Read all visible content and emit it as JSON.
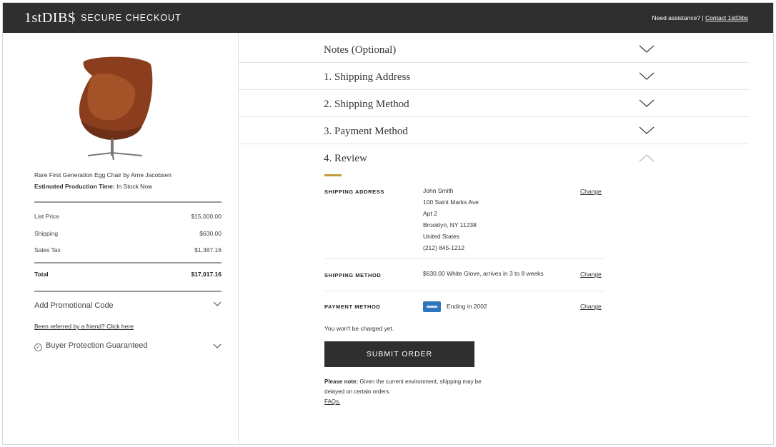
{
  "header": {
    "logo": "1stDIBS",
    "title": "SECURE CHECKOUT",
    "assist_text": "Need assistance? |",
    "contact_link": "Contact 1stDibs"
  },
  "product": {
    "name": "Rare First Generation Egg Chair by Arne Jacobsen",
    "production_label": "Estimated Production Time:",
    "production_value": "In Stock Now"
  },
  "summary": {
    "rows": [
      {
        "label": "List Price",
        "value": "$15,000.00"
      },
      {
        "label": "Shipping",
        "value": "$630.00"
      },
      {
        "label": "Sales Tax",
        "value": "$1,387.16"
      }
    ],
    "total_label": "Total",
    "total_value": "$17,017.16"
  },
  "promo": {
    "label": "Add Promotional Code",
    "referral": "Been referred by a friend? Click here",
    "protection": "Buyer Protection Guaranteed"
  },
  "sections": [
    {
      "title": "Notes (Optional)"
    },
    {
      "title": "1. Shipping Address"
    },
    {
      "title": "2. Shipping Method"
    },
    {
      "title": "3. Payment Method"
    },
    {
      "title": "4. Review"
    }
  ],
  "review": {
    "shipping_address_label": "SHIPPING ADDRESS",
    "address_lines": [
      "John Smith",
      "100 Saint Marks Ave",
      "Apt 2",
      "Brooklyn, NY 11238",
      "United States",
      "(212) 845-1212"
    ],
    "shipping_method_label": "SHIPPING METHOD",
    "shipping_method_value": "$630.00 White Glove, arrives in 3 to 8 weeks",
    "payment_method_label": "PAYMENT METHOD",
    "payment_method_value": "Ending in 2002",
    "change_label": "Change",
    "not_charged": "You won't be charged yet.",
    "submit_label": "SUBMIT ORDER",
    "please_note_label": "Please note:",
    "please_note_text": "Given the current environment, shipping may be delayed on certain orders.",
    "faqs": "FAQs."
  },
  "colors": {
    "header_bg": "#2f2f2f",
    "accent": "#c49a3c",
    "amex": "#2e77bc"
  }
}
